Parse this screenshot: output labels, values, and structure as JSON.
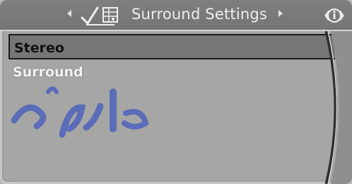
{
  "header": {
    "title": "Surround Settings",
    "left_arrow_icon": "triangle-left-icon",
    "right_arrow_icon": "triangle-right-icon",
    "audio_icon": "speaker-surround-icon",
    "info_icon": "info-scroll-icon"
  },
  "menu": {
    "items": [
      {
        "label": "Stereo",
        "selected": true
      },
      {
        "label": "Surround",
        "selected": false
      }
    ]
  },
  "watermark": {
    "text": "امداد خو",
    "color": "#1f3fc8"
  },
  "colors": {
    "screen_bg": "#a6a7a5",
    "header_bg": "#747674",
    "selected_bg": "#757775",
    "text_light": "#ededed"
  }
}
